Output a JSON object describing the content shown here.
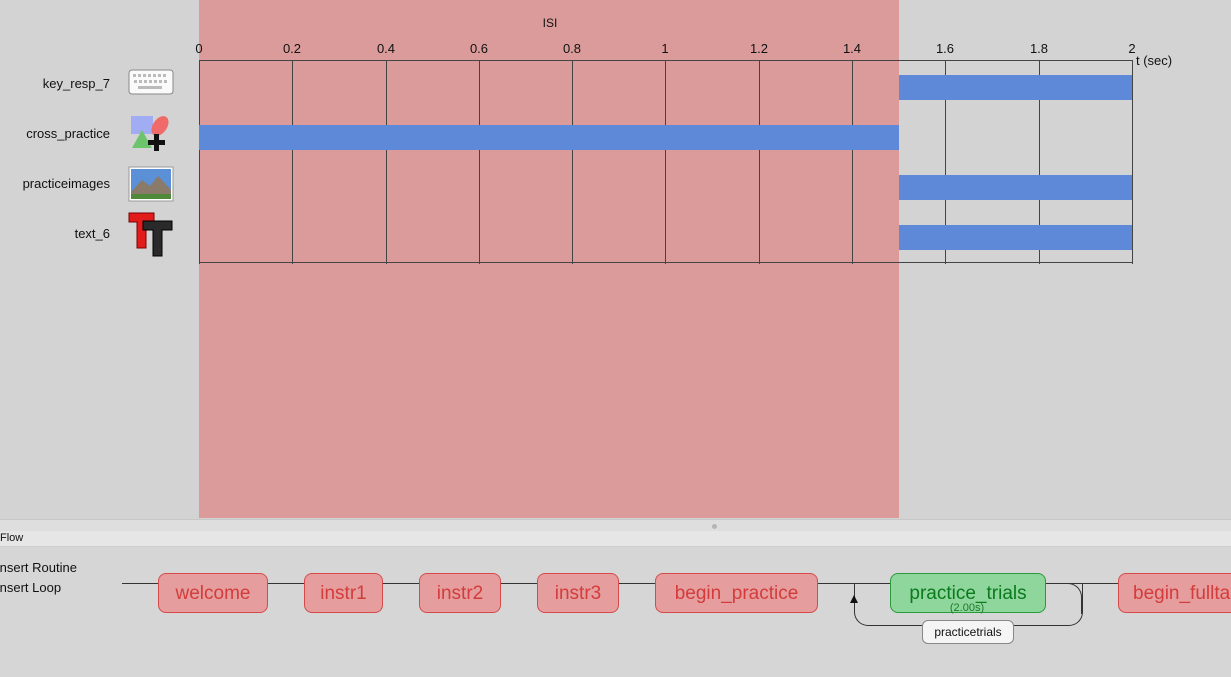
{
  "routine_view": {
    "routine_label": "ISI",
    "ticks": [
      "0",
      "0.2",
      "0.4",
      "0.6",
      "0.8",
      "1",
      "1.2",
      "1.4",
      "1.6",
      "1.8",
      "2"
    ],
    "time_unit": "t (sec)",
    "components": [
      {
        "name": "key_resp_7",
        "icon": "keyboard-icon"
      },
      {
        "name": "cross_practice",
        "icon": "polygon-shapes-icon"
      },
      {
        "name": "practiceimages",
        "icon": "image-icon"
      },
      {
        "name": "text_6",
        "icon": "text-tt-icon"
      }
    ]
  },
  "flow": {
    "header": "Flow",
    "insert_routine": "Insert Routine",
    "insert_loop": "Insert Loop",
    "routines": [
      {
        "label": "welcome"
      },
      {
        "label": "instr1"
      },
      {
        "label": "instr2"
      },
      {
        "label": "instr3"
      },
      {
        "label": "begin_practice"
      },
      {
        "label": "practice_trials",
        "active": true
      },
      {
        "label": "begin_fulltask"
      }
    ],
    "active_duration": "(2.00s)",
    "loop_label": "practicetrials"
  },
  "colors": {
    "routine_highlight": "#dc9b9b",
    "component_bar": "#5e89d8",
    "routine_box": "#e59d9d",
    "routine_active": "#8fd69c"
  }
}
